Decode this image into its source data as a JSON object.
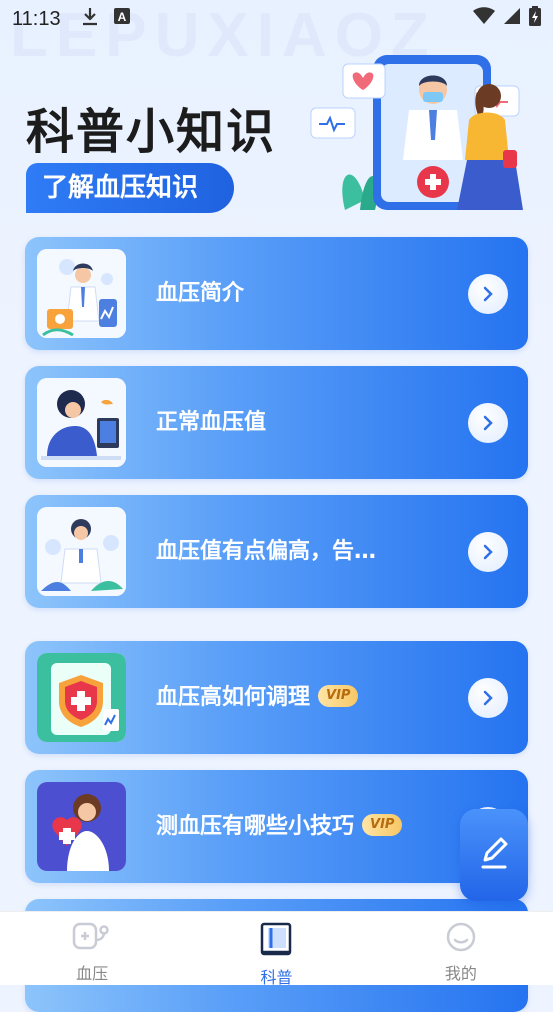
{
  "status_bar": {
    "time": "11:13"
  },
  "watermark": "LEPUXIAOZ",
  "header": {
    "title": "科普小知识",
    "subtitle": "了解血压知识"
  },
  "cards": [
    {
      "label": "血压简介",
      "vip": ""
    },
    {
      "label": "正常血压值",
      "vip": ""
    },
    {
      "label": "血压值有点偏高，告…",
      "vip": ""
    },
    {
      "label": "血压高如何调理",
      "vip": "VIP"
    },
    {
      "label": "测血压有哪些小技巧",
      "vip": "VIP"
    }
  ],
  "bottom_nav": [
    {
      "label": "血压",
      "icon": "stethoscope-icon",
      "active": false
    },
    {
      "label": "科普",
      "icon": "book-icon",
      "active": true
    },
    {
      "label": "我的",
      "icon": "smile-icon",
      "active": false
    }
  ],
  "colors": {
    "accent": "#2f6fe8",
    "card_start": "#8dc4fb",
    "card_end": "#2573f0",
    "vip_bg": "#f7c765"
  }
}
